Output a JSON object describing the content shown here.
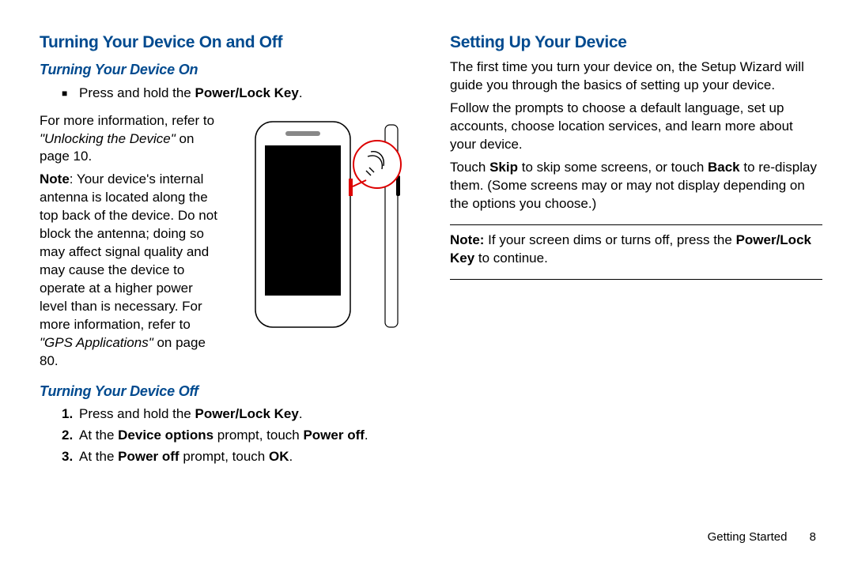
{
  "left": {
    "h1": "Turning Your Device On and Off",
    "on": {
      "h2": "Turning Your Device On",
      "bullet_pre": "Press and hold the ",
      "bullet_bold": "Power/Lock Key",
      "bullet_post": ".",
      "info_pre": "For more information, refer to ",
      "info_ref": "\"Unlocking the Device\"",
      "info_post": " on page 10.",
      "note_label": "Note",
      "note_body_1": ": Your device's internal antenna is located along the top back of the device. Do not block the antenna; doing so may affect signal quality and may cause the device to operate at a higher power level than is necessary. For more information, refer to ",
      "note_ref": "\"GPS Applications\"",
      "note_body_2": " on page 80."
    },
    "off": {
      "h2": "Turning Your Device Off",
      "steps": [
        {
          "n": "1.",
          "pre": "Press and hold the ",
          "b1": "Power/Lock Key",
          "post": "."
        },
        {
          "n": "2.",
          "pre": "At the ",
          "b1": "Device options",
          "mid": " prompt, touch ",
          "b2": "Power off",
          "post": "."
        },
        {
          "n": "3.",
          "pre": "At the ",
          "b1": "Power off",
          "mid": " prompt, touch ",
          "b2": "OK",
          "post": "."
        }
      ]
    }
  },
  "right": {
    "h1": "Setting Up Your Device",
    "p1": "The first time you turn your device on, the Setup Wizard will guide you through the basics of setting up your device.",
    "p2": "Follow the prompts to choose a default language, set up accounts, choose location services, and learn more about your device.",
    "p3_pre": "Touch ",
    "p3_b1": "Skip",
    "p3_mid": " to skip some screens, or touch ",
    "p3_b2": "Back",
    "p3_post": " to re-display them. (Some screens may or may not display depending on the options you choose.)",
    "note_label": "Note:",
    "note_pre": " If your screen dims or turns off, press the ",
    "note_b": "Power/Lock Key",
    "note_post": " to continue."
  },
  "footer": {
    "section": "Getting Started",
    "page": "8"
  },
  "illustration": {
    "name": "phone-power-button-diagram"
  }
}
